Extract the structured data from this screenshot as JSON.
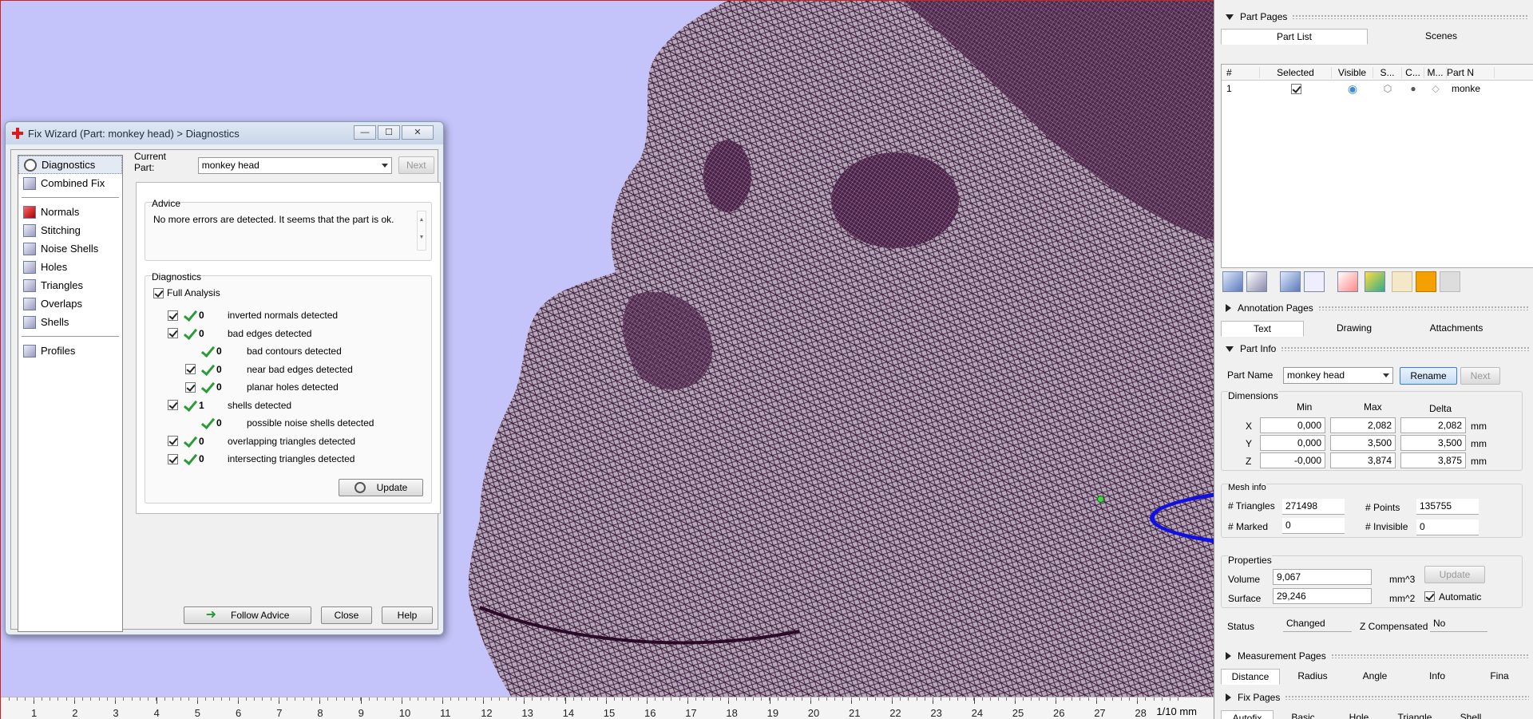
{
  "ruler": {
    "ticks": [
      "1",
      "2",
      "3",
      "4",
      "5",
      "6",
      "7",
      "8",
      "9",
      "10",
      "11",
      "12",
      "13",
      "14",
      "15",
      "16",
      "17",
      "18",
      "19",
      "20",
      "21",
      "22",
      "23",
      "24",
      "25",
      "26",
      "27",
      "28"
    ],
    "unit": "1/10 mm"
  },
  "fix_wizard": {
    "title": "Fix Wizard (Part: monkey head) > Diagnostics",
    "window_buttons": {
      "minimize": "—",
      "maximize": "☐",
      "close": "✕"
    },
    "nav": {
      "group1": [
        {
          "label": "Diagnostics",
          "icon": "search-icon",
          "selected": true
        },
        {
          "label": "Combined Fix",
          "icon": "cube-icon"
        }
      ],
      "group2": [
        {
          "label": "Normals",
          "icon": "normals-icon"
        },
        {
          "label": "Stitching",
          "icon": "stitching-icon"
        },
        {
          "label": "Noise Shells",
          "icon": "noise-shells-icon"
        },
        {
          "label": "Holes",
          "icon": "holes-icon"
        },
        {
          "label": "Triangles",
          "icon": "triangles-icon"
        },
        {
          "label": "Overlaps",
          "icon": "overlaps-icon"
        },
        {
          "label": "Shells",
          "icon": "shells-icon"
        }
      ],
      "group3": [
        {
          "label": "Profiles",
          "icon": "profiles-icon"
        }
      ]
    },
    "current_part_label": "Current Part:",
    "current_part_value": "monkey head",
    "next_label": "Next",
    "advice_title": "Advice",
    "advice_text": "No more errors are detected. It seems that the part is ok.",
    "diagnostics_title": "Diagnostics",
    "full_analysis_label": "Full Analysis",
    "rows": [
      {
        "checkbox": true,
        "count": "0",
        "label": "inverted normals detected",
        "indent": 0
      },
      {
        "checkbox": true,
        "count": "0",
        "label": "bad edges detected",
        "indent": 0
      },
      {
        "checkbox": false,
        "count": "0",
        "label": "bad contours detected",
        "indent": 1
      },
      {
        "checkbox": true,
        "count": "0",
        "label": "near bad edges detected",
        "indent": 1
      },
      {
        "checkbox": true,
        "count": "0",
        "label": "planar holes detected",
        "indent": 1
      },
      {
        "checkbox": true,
        "count": "1",
        "label": "shells detected",
        "indent": 0
      },
      {
        "checkbox": false,
        "count": "0",
        "label": "possible noise shells detected",
        "indent": 1
      },
      {
        "checkbox": true,
        "count": "0",
        "label": "overlapping triangles detected",
        "indent": 0
      },
      {
        "checkbox": true,
        "count": "0",
        "label": "intersecting triangles detected",
        "indent": 0
      }
    ],
    "update_label": "Update",
    "follow_advice_label": "Follow Advice",
    "close_label": "Close",
    "help_label": "Help"
  },
  "right_panel": {
    "part_pages": {
      "title": "Part Pages",
      "tabs": [
        "Part List",
        "Scenes"
      ],
      "table_headers": [
        "#",
        "Selected",
        "Visible",
        "S...",
        "C...",
        "M...",
        "Part N"
      ],
      "row": {
        "num": "1",
        "name": "monke"
      }
    },
    "annotation_pages": {
      "title": "Annotation Pages",
      "tabs": [
        "Text",
        "Drawing",
        "Attachments"
      ]
    },
    "part_info": {
      "title": "Part Info",
      "part_name_label": "Part Name",
      "part_name_value": "monkey head",
      "rename_label": "Rename",
      "next_label": "Next",
      "dimensions_title": "Dimensions",
      "dim_headers": [
        "Min",
        "Max",
        "Delta"
      ],
      "dims": [
        {
          "axis": "X",
          "min": "0,000",
          "max": "2,082",
          "delta": "2,082",
          "unit": "mm"
        },
        {
          "axis": "Y",
          "min": "0,000",
          "max": "3,500",
          "delta": "3,500",
          "unit": "mm"
        },
        {
          "axis": "Z",
          "min": "-0,000",
          "max": "3,874",
          "delta": "3,875",
          "unit": "mm"
        }
      ],
      "mesh_info_title": "Mesh info",
      "triangles_label": "# Triangles",
      "triangles_value": "271498",
      "points_label": "# Points",
      "points_value": "135755",
      "marked_label": "# Marked",
      "marked_value": "0",
      "invisible_label": "# Invisible",
      "invisible_value": "0",
      "properties_title": "Properties",
      "volume_label": "Volume",
      "volume_value": "9,067",
      "volume_unit": "mm^3",
      "surface_label": "Surface",
      "surface_value": "29,246",
      "surface_unit": "mm^2",
      "update_label": "Update",
      "automatic_label": "Automatic",
      "status_label": "Status",
      "status_value": "Changed",
      "zcomp_label": "Z Compensated",
      "zcomp_value": "No"
    },
    "measurement_pages": {
      "title": "Measurement Pages",
      "tabs": [
        "Distance",
        "Radius",
        "Angle",
        "Info",
        "Fina"
      ]
    },
    "fix_pages": {
      "title": "Fix Pages",
      "tabs": [
        "Autofix",
        "Basic",
        "Hole",
        "Triangle",
        "Shell"
      ]
    }
  },
  "colors": {
    "viewport_bg": "#c4c4fb",
    "mesh_color": "#3a1438",
    "highlight_ellipse": "#1010e0",
    "check_green": "#2a9b37"
  }
}
